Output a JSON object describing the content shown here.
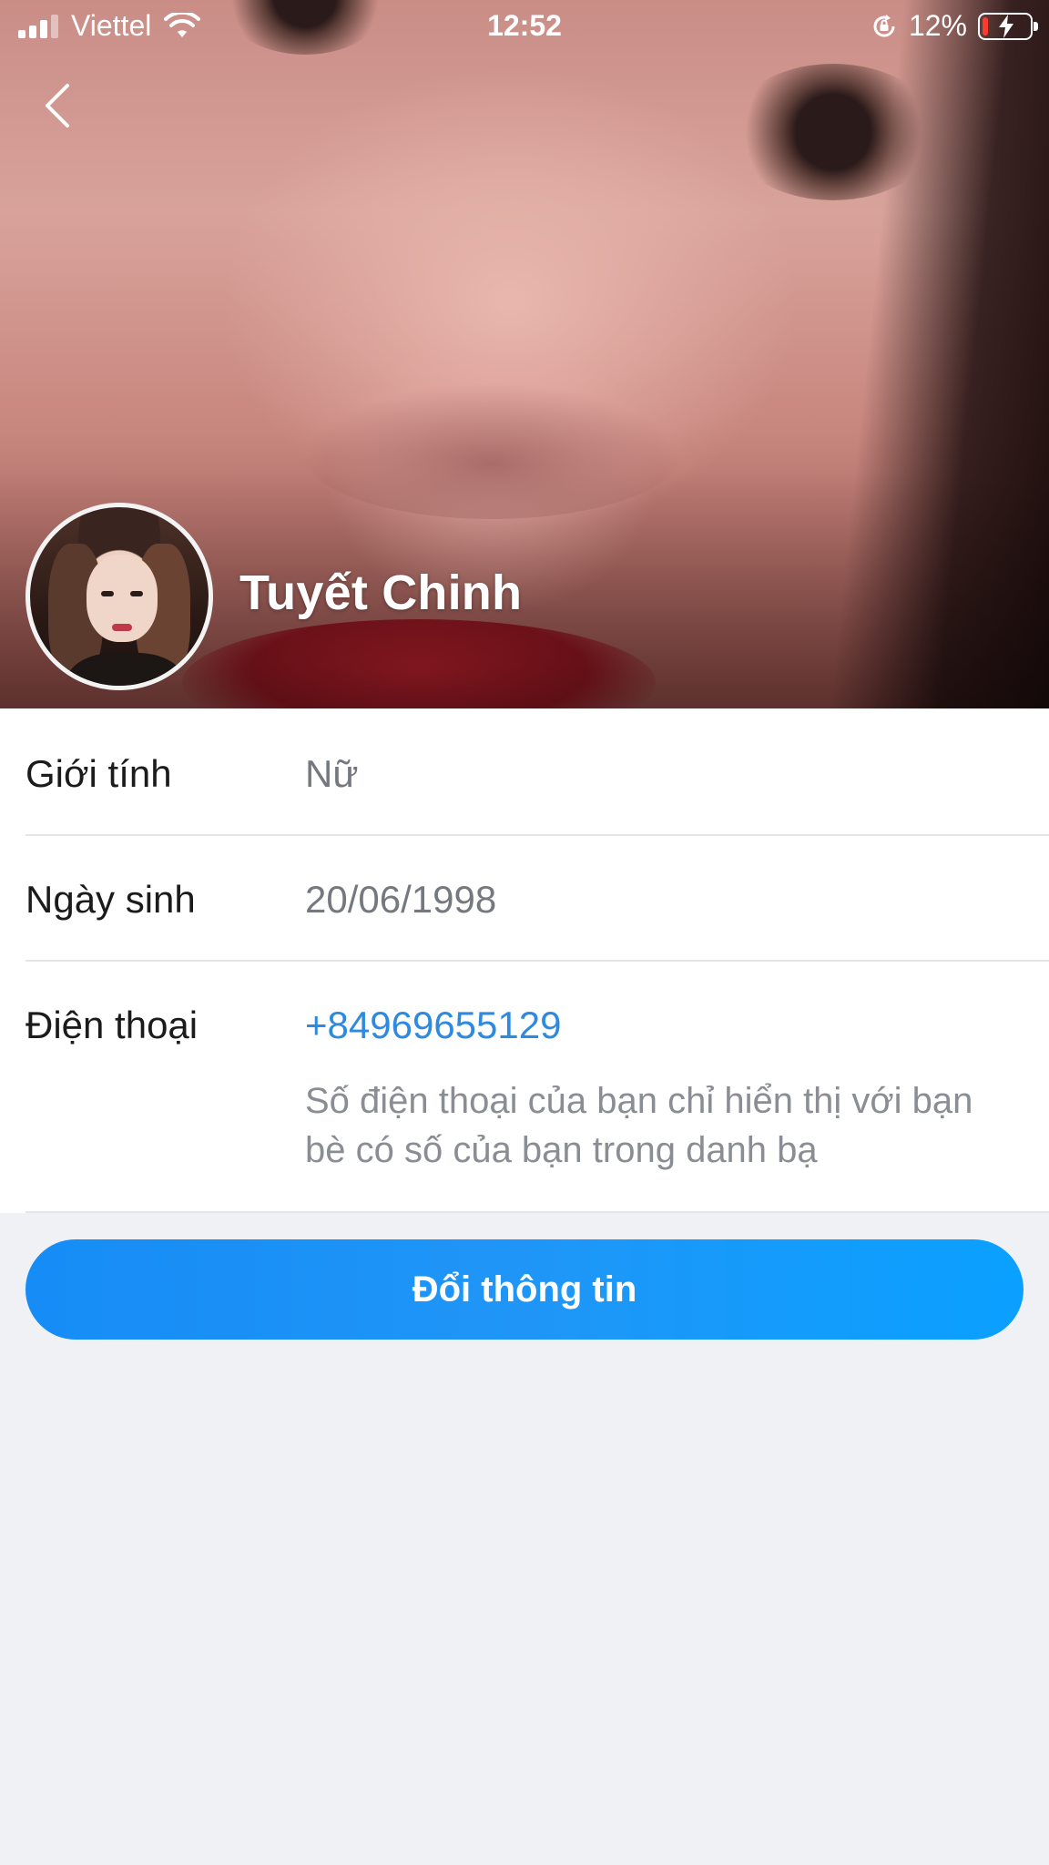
{
  "status_bar": {
    "carrier": "Viettel",
    "time": "12:52",
    "battery_percent": "12%",
    "battery_level": 0.12,
    "battery_color": "#ff3b30",
    "icons": [
      "signal-icon",
      "wifi-icon",
      "rotation-lock-icon",
      "battery-charging-icon"
    ]
  },
  "header": {
    "back_icon": "chevron-left-icon"
  },
  "profile": {
    "name": "Tuyết Chinh"
  },
  "info": {
    "rows": [
      {
        "label": "Giới tính",
        "value": "Nữ"
      },
      {
        "label": "Ngày sinh",
        "value": "20/06/1998"
      },
      {
        "label": "Điện thoại",
        "value": "+84969655129"
      }
    ],
    "phone_note": "Số điện thoại của bạn chỉ hiển thị với bạn bè có số của bạn trong danh bạ"
  },
  "actions": {
    "edit_label": "Đổi thông tin"
  },
  "colors": {
    "accent": "#168cf6",
    "phone_link": "#2d8ae0",
    "background": "#eff1f5"
  }
}
